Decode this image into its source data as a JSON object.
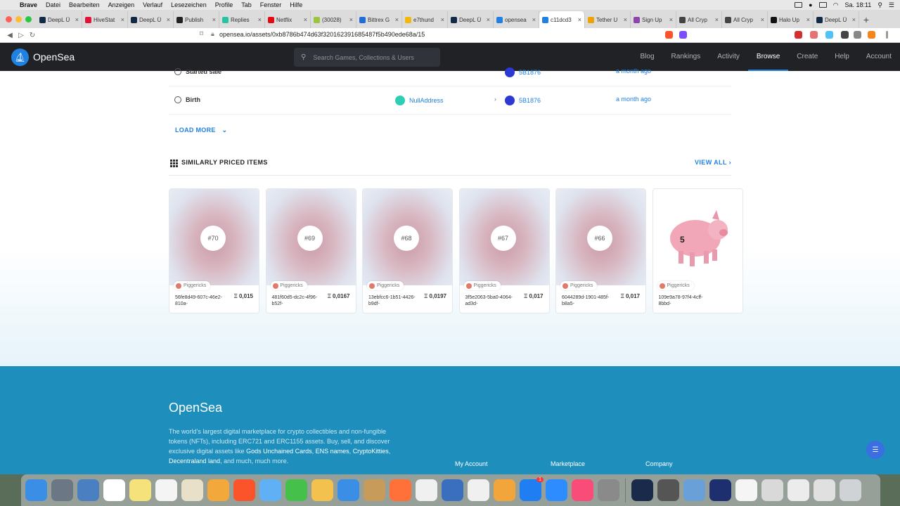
{
  "menubar": {
    "app": "Brave",
    "items": [
      "Datei",
      "Bearbeiten",
      "Anzeigen",
      "Verlauf",
      "Lesezeichen",
      "Profile",
      "Tab",
      "Fenster",
      "Hilfe"
    ],
    "clock": "Sa. 18:11"
  },
  "tabs": [
    {
      "title": "DeepL Ü",
      "color": "#0f2b46"
    },
    {
      "title": "HiveStat",
      "color": "#e31337"
    },
    {
      "title": "DeepL Ü",
      "color": "#0f2b46"
    },
    {
      "title": "Publish",
      "color": "#222222"
    },
    {
      "title": "Replies",
      "color": "#27c3a3"
    },
    {
      "title": "Netflix",
      "color": "#e50914"
    },
    {
      "title": "(30028)",
      "color": "#9bc53d"
    },
    {
      "title": "Bittrex G",
      "color": "#1f6dd6"
    },
    {
      "title": "e7thund",
      "color": "#f0b90b"
    },
    {
      "title": "DeepL Ü",
      "color": "#0f2b46"
    },
    {
      "title": "opensea",
      "color": "#2081e2"
    },
    {
      "title": "c11dcd3",
      "color": "#2081e2"
    },
    {
      "title": "Tether U",
      "color": "#f0a202"
    },
    {
      "title": "Sign Up",
      "color": "#8e44ad"
    },
    {
      "title": "All Cryp",
      "color": "#444444"
    },
    {
      "title": "All Cryp",
      "color": "#444444"
    },
    {
      "title": "Halo Up",
      "color": "#111111"
    },
    {
      "title": "DeepL Ü",
      "color": "#0f2b46"
    }
  ],
  "address": {
    "url": "opensea.io/assets/0xb8786b474d63f320162391685487f5b490ede68a/15"
  },
  "header": {
    "brand": "OpenSea",
    "search_placeholder": "Search Games, Collections & Users",
    "nav": [
      "Blog",
      "Rankings",
      "Activity",
      "Browse",
      "Create",
      "Help",
      "Account"
    ],
    "active_nav": "Browse"
  },
  "history": {
    "rows": [
      {
        "event": "Started sale",
        "from": "",
        "to_name": "5B1876",
        "to_color": "#2c39d4",
        "time": "a month ago"
      },
      {
        "event": "Birth",
        "from": "NullAddress",
        "from_color": "#2ecdb5",
        "to_name": "5B1876",
        "to_color": "#2c39d4",
        "time": "a month ago"
      }
    ],
    "load_more": "LOAD MORE"
  },
  "similar": {
    "title": "SIMILARLY PRICED ITEMS",
    "view_all": "VIEW ALL",
    "items": [
      {
        "badge": "#70",
        "collection": "Piggericks",
        "name": "56fe8d49-607c-46e2-810a-",
        "price": "Ξ 0,015",
        "blurred": true
      },
      {
        "badge": "#69",
        "collection": "Piggericks",
        "name": "481f60d5-dc2c-4f96-b52f-",
        "price": "Ξ 0,0167",
        "blurred": true
      },
      {
        "badge": "#68",
        "collection": "Piggericks",
        "name": "13ebfcc6-1b51-4426-b9df-",
        "price": "Ξ 0,0197",
        "blurred": true
      },
      {
        "badge": "#67",
        "collection": "Piggericks",
        "name": "3f5e2063-5ba0-4064-ad3d-",
        "price": "Ξ 0,017",
        "blurred": true
      },
      {
        "badge": "#66",
        "collection": "Piggericks",
        "name": "6044289d-1901-485f-b8a5-",
        "price": "Ξ 0,017",
        "blurred": true
      },
      {
        "badge": "",
        "collection": "Piggericks",
        "name": "109e9a78-97f4-4cff-8bbd-",
        "price": "",
        "blurred": false,
        "pig_number": "5"
      }
    ]
  },
  "footer": {
    "brand": "OpenSea",
    "desc_start": "The world’s largest digital marketplace for crypto collectibles and non-fungible tokens (NFTs), including ERC721 and ERC1155 assets. Buy, sell, and discover exclusive digital assets like ",
    "link1": "Gods Unchained Cards",
    "sep1": ", ",
    "link2": "ENS names",
    "sep2": ", ",
    "link3": "CryptoKitties",
    "sep3": ", ",
    "link4": "Decentraland land",
    "desc_end": ", and much, much more.",
    "col1": "My Account",
    "col2": "Marketplace",
    "col3": "Company"
  },
  "dock": {
    "apps": [
      "#3a8ee6",
      "#6b7785",
      "#4a7fc1",
      "#ffffff",
      "#f6e27a",
      "#f4f4f4",
      "#e8e0c8",
      "#f2a83b",
      "#fb542b",
      "#5fb0f5",
      "#45c04a",
      "#f2c14e",
      "#3a8ee6",
      "#c79b5a",
      "#ff7139",
      "#f0f0f0",
      "#3a6fc0",
      "#f0f0f0",
      "#f2a53b",
      "#1f7ff2",
      "#2d8cff",
      "#f94c79",
      "#8a8a8a",
      "#1a2a4a",
      "#555555",
      "#6aa0d8",
      "#1d2f6f"
    ],
    "notification": "1"
  }
}
